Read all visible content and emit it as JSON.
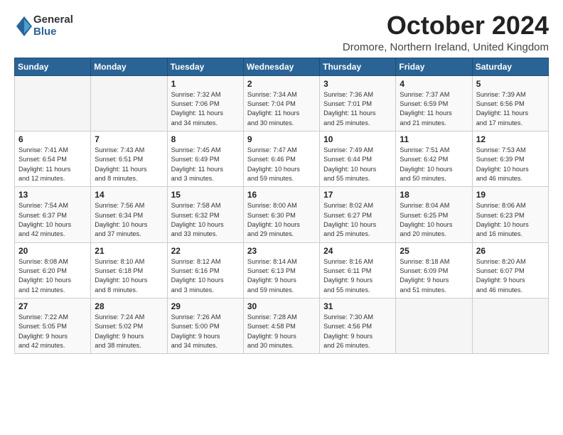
{
  "logo": {
    "general": "General",
    "blue": "Blue"
  },
  "title": "October 2024",
  "location": "Dromore, Northern Ireland, United Kingdom",
  "days_of_week": [
    "Sunday",
    "Monday",
    "Tuesday",
    "Wednesday",
    "Thursday",
    "Friday",
    "Saturday"
  ],
  "weeks": [
    [
      {
        "day": "",
        "content": ""
      },
      {
        "day": "",
        "content": ""
      },
      {
        "day": "1",
        "content": "Sunrise: 7:32 AM\nSunset: 7:06 PM\nDaylight: 11 hours\nand 34 minutes."
      },
      {
        "day": "2",
        "content": "Sunrise: 7:34 AM\nSunset: 7:04 PM\nDaylight: 11 hours\nand 30 minutes."
      },
      {
        "day": "3",
        "content": "Sunrise: 7:36 AM\nSunset: 7:01 PM\nDaylight: 11 hours\nand 25 minutes."
      },
      {
        "day": "4",
        "content": "Sunrise: 7:37 AM\nSunset: 6:59 PM\nDaylight: 11 hours\nand 21 minutes."
      },
      {
        "day": "5",
        "content": "Sunrise: 7:39 AM\nSunset: 6:56 PM\nDaylight: 11 hours\nand 17 minutes."
      }
    ],
    [
      {
        "day": "6",
        "content": "Sunrise: 7:41 AM\nSunset: 6:54 PM\nDaylight: 11 hours\nand 12 minutes."
      },
      {
        "day": "7",
        "content": "Sunrise: 7:43 AM\nSunset: 6:51 PM\nDaylight: 11 hours\nand 8 minutes."
      },
      {
        "day": "8",
        "content": "Sunrise: 7:45 AM\nSunset: 6:49 PM\nDaylight: 11 hours\nand 3 minutes."
      },
      {
        "day": "9",
        "content": "Sunrise: 7:47 AM\nSunset: 6:46 PM\nDaylight: 10 hours\nand 59 minutes."
      },
      {
        "day": "10",
        "content": "Sunrise: 7:49 AM\nSunset: 6:44 PM\nDaylight: 10 hours\nand 55 minutes."
      },
      {
        "day": "11",
        "content": "Sunrise: 7:51 AM\nSunset: 6:42 PM\nDaylight: 10 hours\nand 50 minutes."
      },
      {
        "day": "12",
        "content": "Sunrise: 7:53 AM\nSunset: 6:39 PM\nDaylight: 10 hours\nand 46 minutes."
      }
    ],
    [
      {
        "day": "13",
        "content": "Sunrise: 7:54 AM\nSunset: 6:37 PM\nDaylight: 10 hours\nand 42 minutes."
      },
      {
        "day": "14",
        "content": "Sunrise: 7:56 AM\nSunset: 6:34 PM\nDaylight: 10 hours\nand 37 minutes."
      },
      {
        "day": "15",
        "content": "Sunrise: 7:58 AM\nSunset: 6:32 PM\nDaylight: 10 hours\nand 33 minutes."
      },
      {
        "day": "16",
        "content": "Sunrise: 8:00 AM\nSunset: 6:30 PM\nDaylight: 10 hours\nand 29 minutes."
      },
      {
        "day": "17",
        "content": "Sunrise: 8:02 AM\nSunset: 6:27 PM\nDaylight: 10 hours\nand 25 minutes."
      },
      {
        "day": "18",
        "content": "Sunrise: 8:04 AM\nSunset: 6:25 PM\nDaylight: 10 hours\nand 20 minutes."
      },
      {
        "day": "19",
        "content": "Sunrise: 8:06 AM\nSunset: 6:23 PM\nDaylight: 10 hours\nand 16 minutes."
      }
    ],
    [
      {
        "day": "20",
        "content": "Sunrise: 8:08 AM\nSunset: 6:20 PM\nDaylight: 10 hours\nand 12 minutes."
      },
      {
        "day": "21",
        "content": "Sunrise: 8:10 AM\nSunset: 6:18 PM\nDaylight: 10 hours\nand 8 minutes."
      },
      {
        "day": "22",
        "content": "Sunrise: 8:12 AM\nSunset: 6:16 PM\nDaylight: 10 hours\nand 3 minutes."
      },
      {
        "day": "23",
        "content": "Sunrise: 8:14 AM\nSunset: 6:13 PM\nDaylight: 9 hours\nand 59 minutes."
      },
      {
        "day": "24",
        "content": "Sunrise: 8:16 AM\nSunset: 6:11 PM\nDaylight: 9 hours\nand 55 minutes."
      },
      {
        "day": "25",
        "content": "Sunrise: 8:18 AM\nSunset: 6:09 PM\nDaylight: 9 hours\nand 51 minutes."
      },
      {
        "day": "26",
        "content": "Sunrise: 8:20 AM\nSunset: 6:07 PM\nDaylight: 9 hours\nand 46 minutes."
      }
    ],
    [
      {
        "day": "27",
        "content": "Sunrise: 7:22 AM\nSunset: 5:05 PM\nDaylight: 9 hours\nand 42 minutes."
      },
      {
        "day": "28",
        "content": "Sunrise: 7:24 AM\nSunset: 5:02 PM\nDaylight: 9 hours\nand 38 minutes."
      },
      {
        "day": "29",
        "content": "Sunrise: 7:26 AM\nSunset: 5:00 PM\nDaylight: 9 hours\nand 34 minutes."
      },
      {
        "day": "30",
        "content": "Sunrise: 7:28 AM\nSunset: 4:58 PM\nDaylight: 9 hours\nand 30 minutes."
      },
      {
        "day": "31",
        "content": "Sunrise: 7:30 AM\nSunset: 4:56 PM\nDaylight: 9 hours\nand 26 minutes."
      },
      {
        "day": "",
        "content": ""
      },
      {
        "day": "",
        "content": ""
      }
    ]
  ]
}
